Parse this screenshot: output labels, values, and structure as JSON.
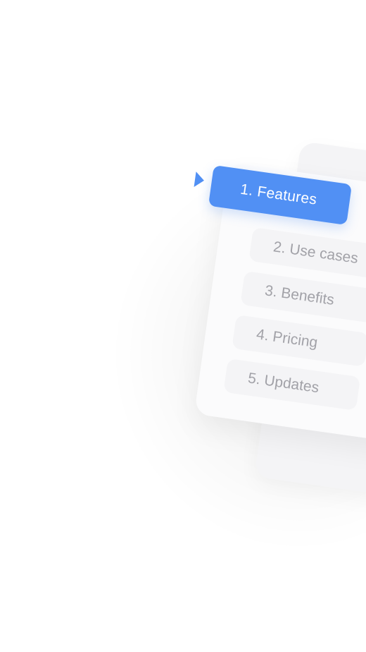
{
  "menu": {
    "items": [
      {
        "label": "1. Features",
        "active": true
      },
      {
        "label": "2. Use cases",
        "active": false
      },
      {
        "label": "3. Benefits",
        "active": false
      },
      {
        "label": "4. Pricing",
        "active": false
      },
      {
        "label": "5. Updates",
        "active": false
      }
    ],
    "accent_color": "#5190f4",
    "indicator_icon": "triangle-right-icon"
  }
}
